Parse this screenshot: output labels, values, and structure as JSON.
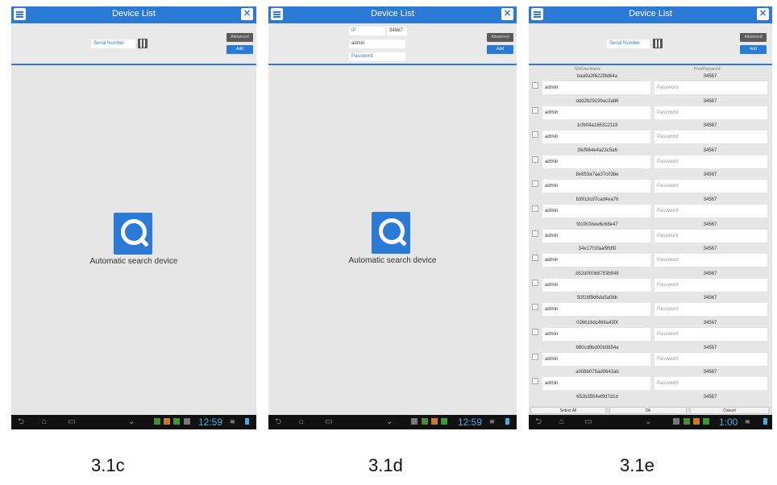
{
  "screens": [
    {
      "title": "Device List",
      "serial_placeholder": "Serial Number",
      "advanced_label": "Advanced",
      "add_label": "Add",
      "search_label": "Automatic search device",
      "clock": "12:59",
      "caption": "3.1c"
    },
    {
      "title": "Device List",
      "ip_placeholder": "IP",
      "port_value": "34567",
      "user_value": "admin",
      "password_placeholder": "Password",
      "advanced_label": "Advanced",
      "add_label": "Add",
      "search_label": "Automatic search device",
      "clock": "12:59",
      "caption": "3.1d"
    },
    {
      "title": "Device List",
      "serial_placeholder": "Serial Number",
      "advanced_label": "Advanced",
      "add_label": "Add",
      "col_sn": "SN/UserName",
      "col_port": "Port/Password",
      "devices": [
        {
          "sn": "baa9a3f622f8d64a",
          "port": "34567",
          "user": "admin",
          "password_placeholder": "Password"
        },
        {
          "sn": "ddd2b29199ac3a86",
          "port": "34567",
          "user": "admin",
          "password_placeholder": "Password"
        },
        {
          "sn": "1cfb04a186312118",
          "port": "34567",
          "user": "admin",
          "password_placeholder": "Password"
        },
        {
          "sn": "3fef964e4a23c5a6",
          "port": "34567",
          "user": "admin",
          "password_placeholder": "Password"
        },
        {
          "sn": "8e853a7aa37c03be",
          "port": "34567",
          "user": "admin",
          "password_placeholder": "Password"
        },
        {
          "sn": "b3913cd7cad4ea76",
          "port": "34567",
          "user": "admin",
          "password_placeholder": "Password"
        },
        {
          "sn": "fd1903bee6c68e47",
          "port": "34567",
          "user": "admin",
          "password_placeholder": "Password"
        },
        {
          "sn": "34e1701faaf9fdf0",
          "port": "34567",
          "user": "admin",
          "password_placeholder": "Password"
        },
        {
          "sn": "b52d000b5753b548",
          "port": "34567",
          "user": "admin",
          "password_placeholder": "Password"
        },
        {
          "sn": "50f16f9d6da5a08b",
          "port": "34567",
          "user": "admin",
          "password_placeholder": "Password"
        },
        {
          "sn": "026b16dc466a430f",
          "port": "34567",
          "user": "admin",
          "password_placeholder": "Password"
        },
        {
          "sn": "680cd9bd00b0854a",
          "port": "34567",
          "user": "admin",
          "password_placeholder": "Password"
        },
        {
          "sn": "a008b075ad0643ab",
          "port": "34567",
          "user": "admin",
          "password_placeholder": "Password"
        },
        {
          "sn": "652b3554ef9d7d1d",
          "port": "34567"
        }
      ],
      "select_all_label": "Select All",
      "ok_label": "Ok",
      "cancel_label": "Cancel",
      "clock": "1:00",
      "caption": "3.1e"
    }
  ],
  "colors": {
    "accent": "#2a7ad6",
    "clock": "#45aee8",
    "background": "#e6e6e6"
  }
}
